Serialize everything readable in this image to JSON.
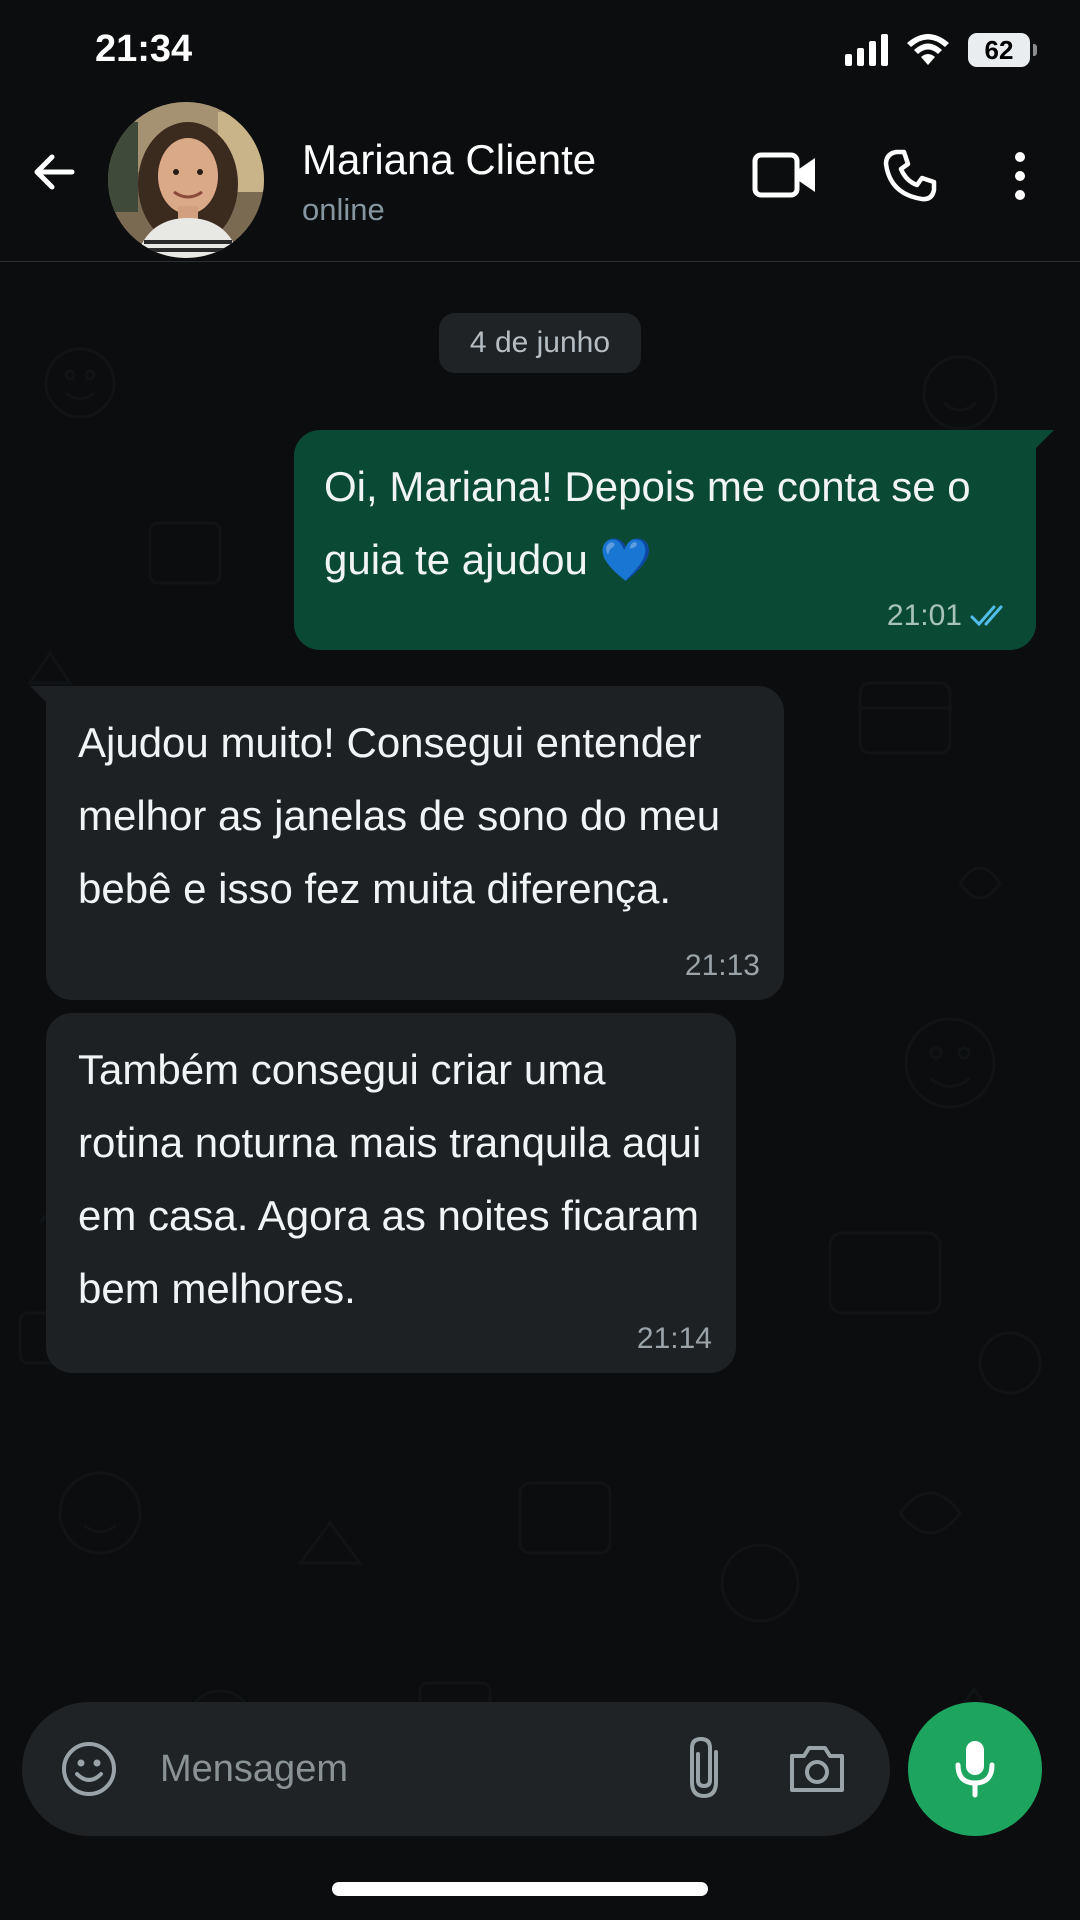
{
  "status_bar": {
    "time": "21:34",
    "battery": "62",
    "icons": [
      "signal-icon",
      "wifi-icon",
      "battery-icon"
    ]
  },
  "header": {
    "contact_name": "Mariana Cliente",
    "contact_status": "online",
    "icons": [
      "back-arrow-icon",
      "avatar",
      "video-call-icon",
      "phone-icon",
      "more-vertical-icon"
    ]
  },
  "chat": {
    "date_chip": "4 de junho",
    "messages": [
      {
        "direction": "outgoing",
        "text": "Oi, Mariana! Depois me conta se o guia te ajudou 💙",
        "time": "21:01",
        "status": "read",
        "status_icon": "double-check-icon"
      },
      {
        "direction": "incoming",
        "text": "Ajudou muito! Consegui entender melhor as janelas de sono do meu bebê e isso fez muita diferença.",
        "time": "21:13"
      },
      {
        "direction": "incoming",
        "text": "Também consegui criar uma rotina noturna mais tranquila aqui em casa. Agora as noites ficaram bem melhores.",
        "time": "21:14"
      }
    ]
  },
  "composer": {
    "placeholder": "Mensagem",
    "value": "",
    "icons": [
      "emoji-icon",
      "paperclip-icon",
      "camera-icon",
      "microphone-icon"
    ]
  },
  "colors": {
    "background": "#0b0d0e",
    "outgoing_bubble": "#0a4a35",
    "incoming_bubble": "#1e2124",
    "accent_green": "#1da55f",
    "read_ticks": "#53bdeb"
  }
}
